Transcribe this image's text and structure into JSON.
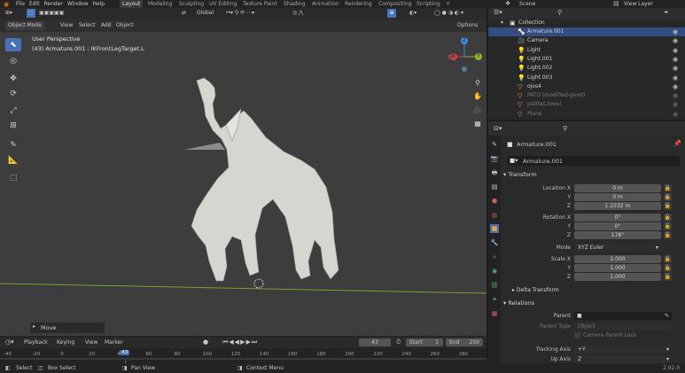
{
  "topbar": {
    "menus": [
      "File",
      "Edit",
      "Render",
      "Window",
      "Help"
    ],
    "workspaces": [
      "Layout",
      "Modeling",
      "Sculpting",
      "UV Editing",
      "Texture Paint",
      "Shading",
      "Animation",
      "Rendering",
      "Compositing",
      "Scripting"
    ],
    "active_workspace": "Layout",
    "add_tab": "+",
    "scene": "Scene",
    "view_layer": "View Layer"
  },
  "viewport": {
    "mode": "Object Mode",
    "menus": [
      "View",
      "Select",
      "Add",
      "Object"
    ],
    "transform_orientation": "Global",
    "options": "Options",
    "title": "User Perspective",
    "subtitle": "(43) Armature.001 : IKFrontLegTarget.L",
    "last_op": "Move",
    "gizmo_axes": {
      "x": "X",
      "y": "Y",
      "z": "Z"
    }
  },
  "outliner": {
    "header": "Collection",
    "rows": [
      {
        "label": "Armature.001",
        "icon": "armature-icon",
        "color": "#e0a060",
        "selected": true
      },
      {
        "label": "Camera",
        "icon": "camera-icon",
        "color": "#e0a060"
      },
      {
        "label": "Light",
        "icon": "light-icon",
        "color": "#e0a060"
      },
      {
        "label": "Light.001",
        "icon": "light-icon",
        "color": "#e0a060"
      },
      {
        "label": "Light.002",
        "icon": "light-icon",
        "color": "#e0a060"
      },
      {
        "label": "Light.003",
        "icon": "light-icon",
        "color": "#e0a060"
      },
      {
        "label": "ojos4",
        "icon": "mesh-icon",
        "color": "#e0a060"
      },
      {
        "label": "PATO (modified-good)",
        "icon": "mesh-icon",
        "color": "#e0a060",
        "dim": true
      },
      {
        "label": "patitas.lowel",
        "icon": "mesh-icon",
        "color": "#e0a060",
        "dim": true
      },
      {
        "label": "Plane",
        "icon": "mesh-icon",
        "color": "#e0a060",
        "dim": true
      }
    ]
  },
  "properties": {
    "object_name": "Armature.001",
    "object_field": "Armature.001",
    "transform_label": "Transform",
    "location": {
      "label": "Location X",
      "x": "0 m",
      "y": "0 m",
      "z": "1.2232 m"
    },
    "rotation": {
      "label": "Rotation X",
      "x": "0°",
      "y": "0°",
      "z": "178°"
    },
    "mode_label": "Mode",
    "mode_value": "XYZ Euler",
    "scale": {
      "label": "Scale X",
      "x": "1.000",
      "y": "1.000",
      "z": "1.000"
    },
    "axis_y": "Y",
    "axis_z": "Z",
    "delta_label": "Delta Transform",
    "relations_label": "Relations",
    "parent_label": "Parent",
    "parent_type_label": "Parent Type",
    "parent_type_value": "Object",
    "camera_parent_lock": "Camera Parent Lock",
    "tracking_label": "Tracking Axis",
    "tracking_value": "+Y",
    "up_label": "Up Axis",
    "up_value": "Z",
    "version": "2.92.0"
  },
  "timeline": {
    "menus": [
      "Playback",
      "Keying",
      "View",
      "Marker"
    ],
    "current_frame": "43",
    "start_label": "Start",
    "start": "1",
    "end_label": "End",
    "end": "250",
    "ticks": [
      "-40",
      "-20",
      "0",
      "20",
      "40",
      "60",
      "80",
      "100",
      "120",
      "140",
      "160",
      "180",
      "200",
      "220",
      "240",
      "260",
      "280"
    ]
  },
  "status": {
    "select": "Select",
    "box_select": "Box Select",
    "pan_view": "Pan View",
    "context_menu": "Context Menu"
  },
  "colors": {
    "accent": "#4772b3",
    "x_axis": "#d9404a",
    "y_axis": "#8ab82a",
    "z_axis": "#3c8ce6",
    "playhead": "#4772b3"
  }
}
